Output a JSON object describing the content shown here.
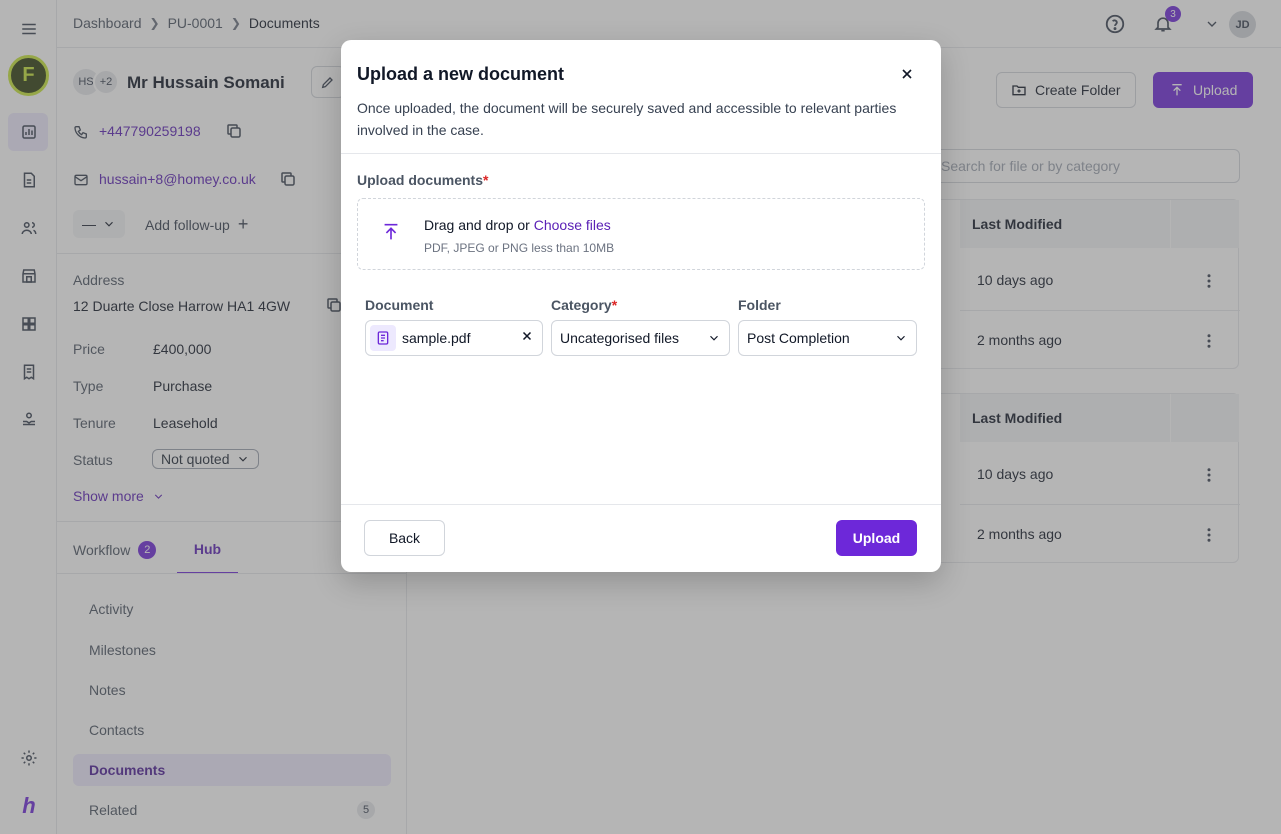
{
  "breadcrumb": {
    "items": [
      "Dashboard",
      "PU-0001",
      "Documents"
    ]
  },
  "header": {
    "notifications_count": "3",
    "user_initials": "JD"
  },
  "case": {
    "avatar_initials": "HS",
    "extra_count": "+2",
    "name": "Mr Hussain Somani",
    "phone": "+447790259198",
    "email": "hussain+8@homey.co.uk",
    "dash_select": "—",
    "add_followup": "Add follow-up",
    "address_label": "Address",
    "address": "12 Duarte Close Harrow HA1 4GW",
    "details": [
      {
        "label": "Price",
        "value": "£400,000"
      },
      {
        "label": "Type",
        "value": "Purchase"
      },
      {
        "label": "Tenure",
        "value": "Leasehold"
      },
      {
        "label": "Status",
        "value": "Not quoted"
      }
    ],
    "show_more": "Show more"
  },
  "panel_tabs": {
    "workflow_label": "Workflow",
    "workflow_count": "2",
    "hub_label": "Hub"
  },
  "hub_nav": [
    {
      "label": "Activity"
    },
    {
      "label": "Milestones"
    },
    {
      "label": "Notes"
    },
    {
      "label": "Contacts"
    },
    {
      "label": "Documents"
    },
    {
      "label": "Related",
      "count": "5"
    }
  ],
  "main": {
    "create_folder": "Create Folder",
    "upload": "Upload",
    "search_placeholder": "Search for file or by category",
    "column_last_modified": "Last Modified",
    "rows_top": [
      "10 days ago",
      "2 months ago"
    ],
    "rows_bottom": [
      "10 days ago",
      "2 months ago"
    ]
  },
  "modal": {
    "title": "Upload a new document",
    "description": "Once uploaded, the document will be securely saved and accessible to relevant parties involved in the case.",
    "upload_label": "Upload documents",
    "required_mark": "*",
    "drag_text": "Drag and drop or",
    "choose_files": "Choose files",
    "hint": "PDF, JPEG or PNG less than 10MB",
    "document_label": "Document",
    "category_label": "Category",
    "folder_label": "Folder",
    "file_name": "sample.pdf",
    "category_value": "Uncategorised files",
    "folder_value": "Post Completion",
    "back": "Back",
    "upload": "Upload"
  },
  "colors": {
    "accent": "#6d28d9",
    "accent_light": "#ede9fe",
    "required": "#dc2626"
  }
}
